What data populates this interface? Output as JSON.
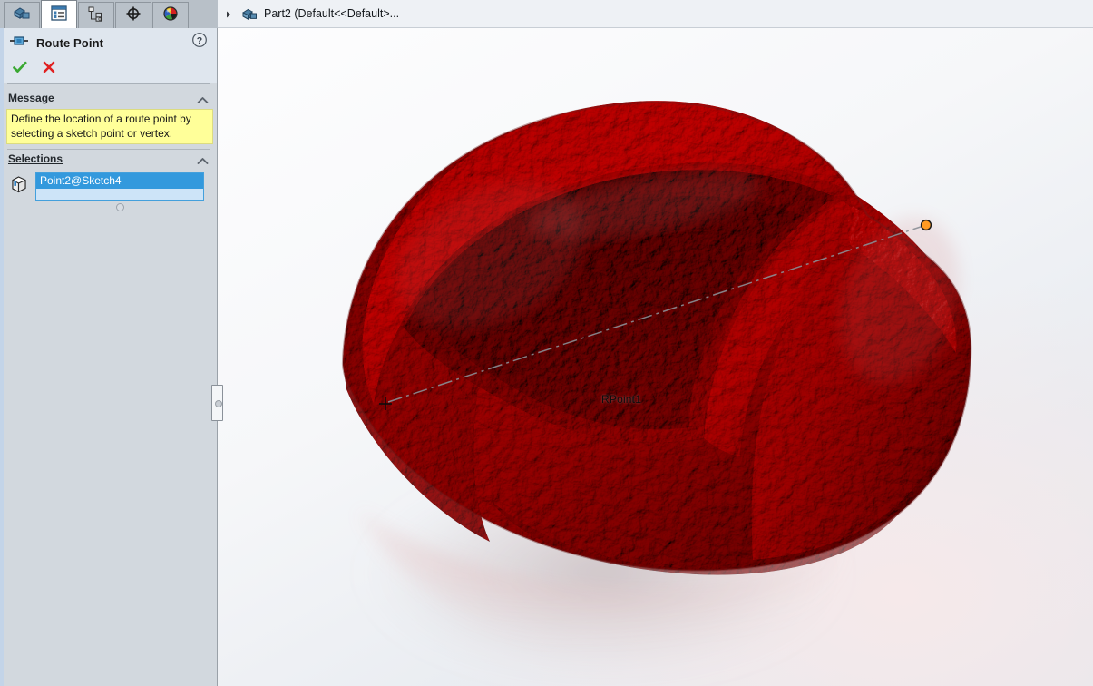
{
  "panel": {
    "tabs": [
      {
        "name": "feature-manager-tree",
        "icon": "part-tree-icon",
        "active": false,
        "title": "FeatureManager design tree"
      },
      {
        "name": "property-manager",
        "icon": "property-list-icon",
        "active": true,
        "title": "PropertyManager"
      },
      {
        "name": "configuration-manager",
        "icon": "configuration-icon",
        "active": false,
        "title": "ConfigurationManager"
      },
      {
        "name": "dimxpert-manager",
        "icon": "crosshair-icon",
        "active": false,
        "title": "DimXpertManager"
      },
      {
        "name": "display-manager",
        "icon": "display-sphere-icon",
        "active": false,
        "title": "DisplayManager"
      }
    ],
    "header": {
      "title": "Route Point",
      "icon": "route-point-icon",
      "help_label": "?",
      "accept_label": "✓",
      "cancel_label": "✕"
    },
    "sections": [
      {
        "id": "message",
        "label": "Message",
        "accelerator": "",
        "collapsed": false,
        "message_text": "Define the location of a route point by selecting a sketch point or vertex."
      },
      {
        "id": "selections",
        "label": "Selections",
        "accelerator": "S",
        "collapsed": false
      }
    ],
    "selections": {
      "icon": "vertex-cube-icon",
      "items": [
        {
          "label": "Point2@Sketch4",
          "selected": true
        }
      ]
    }
  },
  "breadcrumb": {
    "expand_icon": "chevron-right-icon",
    "part_icon": "part-icon",
    "text": "Part2  (Default<<Default>..."
  },
  "viewport": {
    "model_name": "textured-red-part",
    "annotations": [
      {
        "name": "route-point-label",
        "text": "RPoint1",
        "marker": "crosshair-marker"
      }
    ],
    "centerline": {
      "style": "dash-dot",
      "endpoint": "orange-point"
    }
  },
  "colors": {
    "panel_bg": "#d2d8de",
    "panel_header_bg": "#dfe6ee",
    "tab_strip_bg": "#b8c0c8",
    "message_yellow": "#ffff99",
    "selection_highlight": "#3399dd",
    "selection_field": "#cde4f8",
    "selection_border": "#44a0dc",
    "accept_green": "#3aa832",
    "cancel_red": "#e02020",
    "model_red_dark": "#7e1f1f",
    "model_red_mid": "#a63434",
    "model_red_light": "#c25050",
    "centerline_gray": "#8a8f96",
    "endpoint_orange": "#ff9a22",
    "breadcrumb_bg": "#eef1f5"
  }
}
